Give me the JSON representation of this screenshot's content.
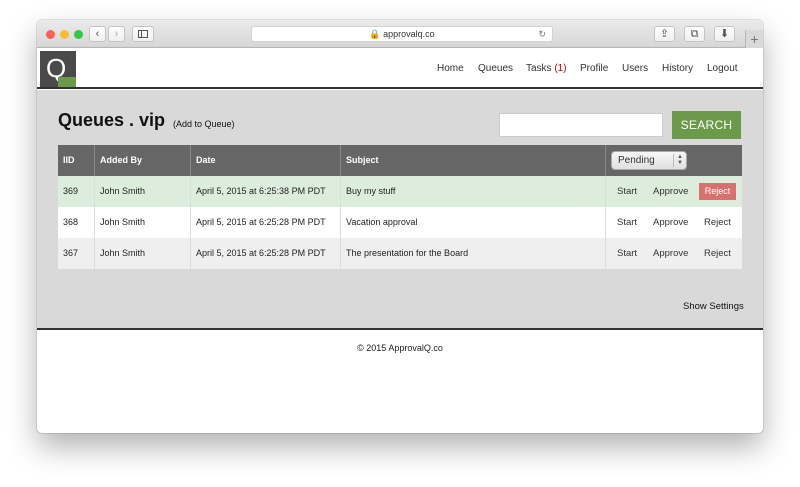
{
  "browser": {
    "url": "approvalq.co",
    "new_tab_label": "+",
    "colors": {
      "close": "#fc5f57",
      "minimize": "#fdbc2e",
      "maximize": "#33c748"
    }
  },
  "site": {
    "logo_letter": "Q",
    "nav": [
      {
        "label": "Home"
      },
      {
        "label": "Queues"
      },
      {
        "label": "Tasks",
        "badge": "(1)"
      },
      {
        "label": "Profile"
      },
      {
        "label": "Users"
      },
      {
        "label": "History"
      },
      {
        "label": "Logout"
      }
    ]
  },
  "page": {
    "title": "Queues . vip",
    "add_link": "(Add to Queue)",
    "search": {
      "value": "",
      "placeholder": ""
    },
    "search_button": "SEARCH",
    "accent": "#6a9a4a"
  },
  "table": {
    "headers": [
      "IID",
      "Added By",
      "Date",
      "Subject"
    ],
    "filter_selected": "Pending",
    "rows": [
      {
        "iid": "369",
        "added_by": "John Smith",
        "date": "April 5, 2015 at 6:25:38 PM PDT",
        "subject": "Buy my stuff",
        "start": "Start",
        "approve": "Approve",
        "reject": "Reject",
        "highlight": true
      },
      {
        "iid": "368",
        "added_by": "John Smith",
        "date": "April 5, 2015 at 6:25:28 PM PDT",
        "subject": "Vacation approval",
        "start": "Start",
        "approve": "Approve",
        "reject": "Reject",
        "highlight": false
      },
      {
        "iid": "367",
        "added_by": "John Smith",
        "date": "April 5, 2015 at 6:25:28 PM PDT",
        "subject": "The presentation for the Board",
        "start": "Start",
        "approve": "Approve",
        "reject": "Reject",
        "highlight": false
      }
    ]
  },
  "show_settings": "Show Settings",
  "footer": "© 2015 ApprovalQ.co"
}
